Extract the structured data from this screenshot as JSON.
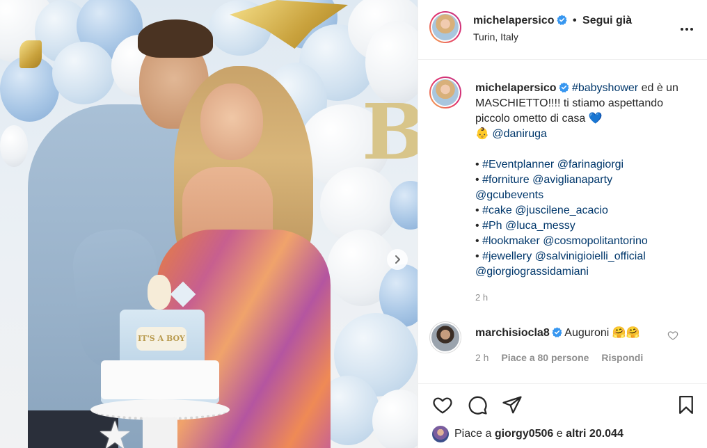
{
  "header": {
    "username": "michelapersico",
    "separator": "•",
    "follow_label": "Segui già",
    "location": "Turin, Italy"
  },
  "photo": {
    "cake_text": "IT'S A BOY"
  },
  "caption": {
    "username": "michelapersico",
    "hashtag": "#babyshower",
    "text_1": " ed è un MASCHIETTO!!!! ti stiamo aspettando piccolo ometto di casa ",
    "emoji_heart": "💙",
    "emoji_baby": "👶",
    "mention": "@daniruga",
    "credits": [
      {
        "bullet": "•",
        "tag": "#Eventplanner",
        "mention": "@farinagiorgi"
      },
      {
        "bullet": "•",
        "tag": "#forniture",
        "mention": "@aviglianaparty"
      },
      {
        "bullet": "",
        "tag": "",
        "mention": "@gcubevents"
      },
      {
        "bullet": "•",
        "tag": "#cake",
        "mention": "@juscilene_acacio"
      },
      {
        "bullet": "•",
        "tag": "#Ph",
        "mention": "@luca_messy"
      },
      {
        "bullet": "•",
        "tag": "#lookmaker",
        "mention": "@cosmopolitantorino"
      },
      {
        "bullet": "•",
        "tag": "#jewellery",
        "mention": "@salvinigioielli_official"
      },
      {
        "bullet": "",
        "tag": "",
        "mention": "@giorgiograssidamiani"
      }
    ],
    "time": "2 h"
  },
  "comment": {
    "username": "marchisiocla8",
    "text": "Auguroni",
    "emoji": "🤗🤗",
    "time": "2 h",
    "likes": "Piace a 80 persone",
    "reply": "Rispondi"
  },
  "likes": {
    "prefix": "Piace a",
    "user": "giorgy0506",
    "middle": "e",
    "others": "altri 20.044"
  },
  "icons": [
    "verified-icon",
    "more-icon",
    "next-arrow-icon",
    "heart-icon",
    "comment-icon",
    "share-icon",
    "bookmark-icon"
  ],
  "colors": {
    "link": "#00376b",
    "verified": "#3897f0",
    "muted": "#8e8e8e"
  }
}
